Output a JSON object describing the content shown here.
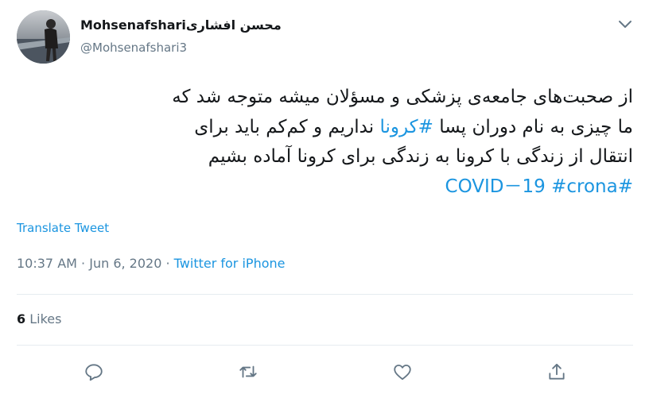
{
  "user": {
    "display_name": "Mohsenafshariمحسن افشاری",
    "handle": "@Mohsenafshari3"
  },
  "tweet": {
    "lines": [
      [
        "از صحبت‌های جامعه‌ی پزشکی و مسؤلان میشه متوجه شد که"
      ],
      [
        "ما چیزی به نام دوران پسا ",
        {
          "tag": "#کرونا"
        },
        " نداریم و کم‌کم باید برای"
      ],
      [
        "انتقال از زندگی با کرونا به زندگی برای کرونا آماده بشیم"
      ],
      [
        {
          "tag": "#COVID－19"
        },
        " ",
        {
          "tag": "#crona"
        }
      ]
    ],
    "translate_label": "Translate Tweet",
    "time": "10:37 AM",
    "date": "Jun 6, 2020",
    "source": "Twitter for iPhone",
    "separator": "·"
  },
  "stats": {
    "likes_count": "6",
    "likes_label": "Likes"
  },
  "colors": {
    "link": "#1b95e0",
    "secondary_text": "#657786",
    "divider": "#e6ecf0"
  },
  "actions": [
    "reply-icon",
    "retweet-icon",
    "like-icon",
    "share-icon"
  ]
}
